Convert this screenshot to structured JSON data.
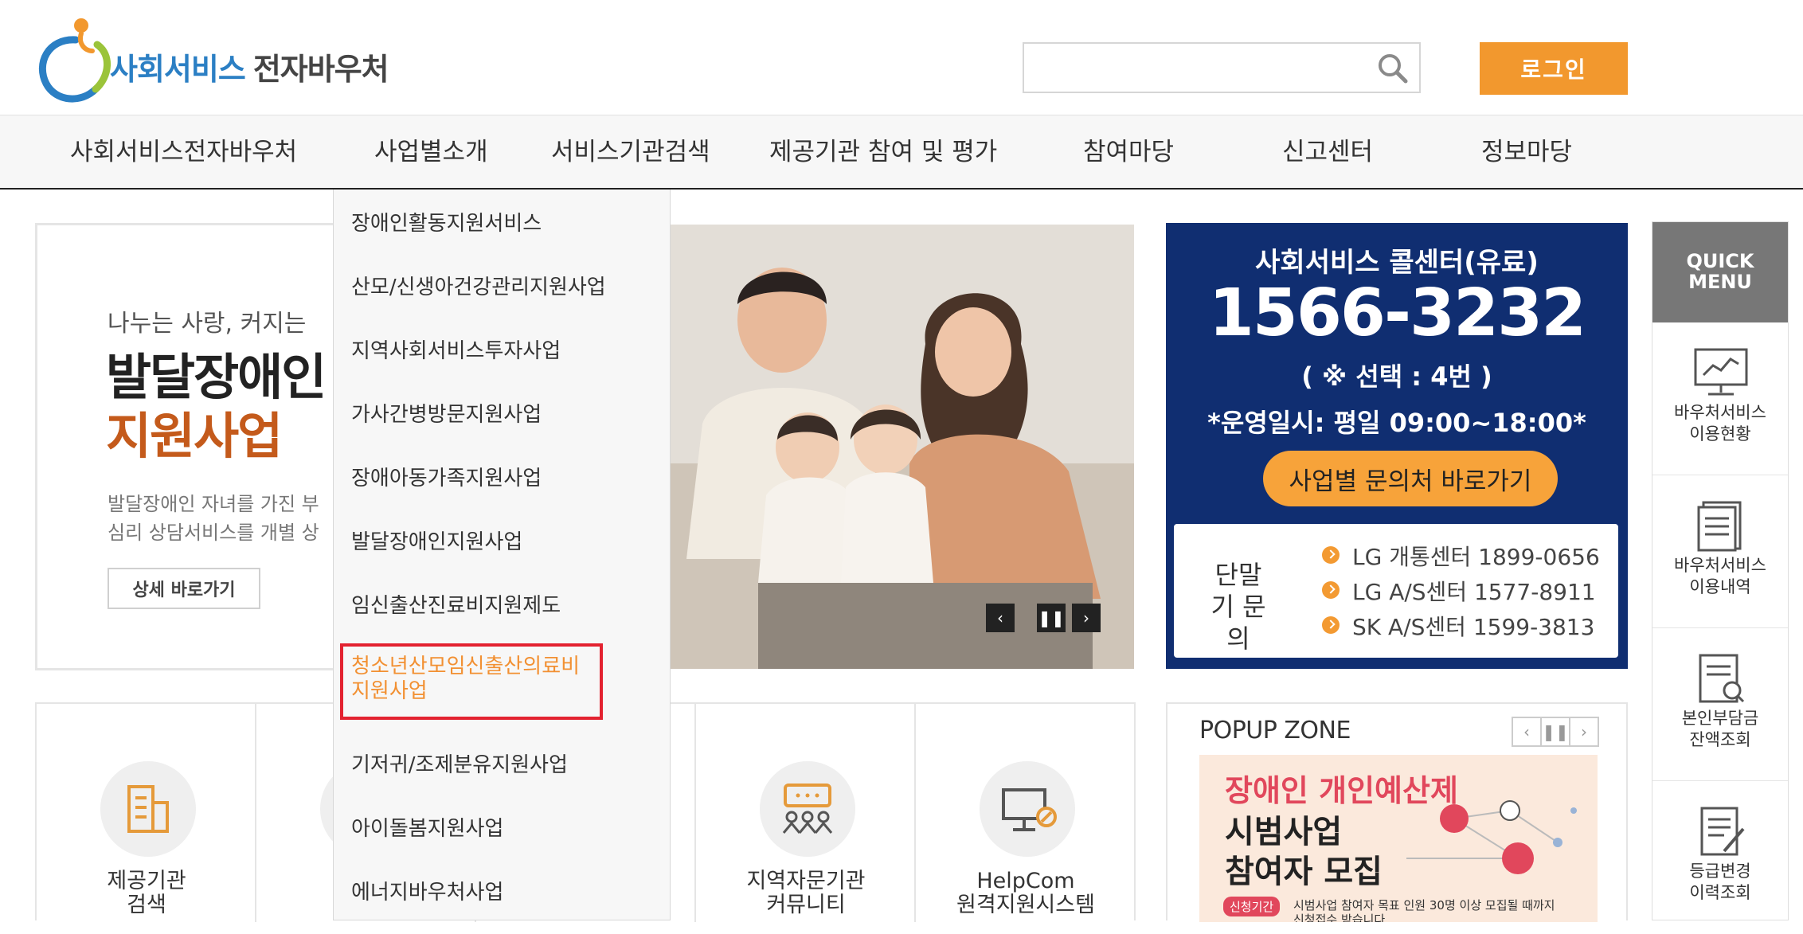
{
  "header": {
    "logo_text_blue": "사회서비스",
    "logo_text_dark": "전자바우처",
    "search_placeholder": "",
    "login_label": "로그인"
  },
  "nav": {
    "items": [
      {
        "label": "사회서비스전자바우처"
      },
      {
        "label": "사업별소개"
      },
      {
        "label": "서비스기관검색"
      },
      {
        "label": "제공기관 참여 및 평가"
      },
      {
        "label": "참여마당"
      },
      {
        "label": "신고센터"
      },
      {
        "label": "정보마당"
      }
    ]
  },
  "dropdown": {
    "items": [
      {
        "label": "장애인활동지원서비스"
      },
      {
        "label": "산모/신생아건강관리지원사업"
      },
      {
        "label": "지역사회서비스투자사업"
      },
      {
        "label": "가사간병방문지원사업"
      },
      {
        "label": "장애아동가족지원사업"
      },
      {
        "label": "발달장애인지원사업"
      },
      {
        "label": "임신출산진료비지원제도"
      },
      {
        "label": "기저귀/조제분유지원사업"
      },
      {
        "label": "아이돌봄지원사업"
      },
      {
        "label": "에너지바우처사업"
      }
    ],
    "highlighted": {
      "line1": "청소년산모임신출산의료비",
      "line2": "지원사업"
    }
  },
  "banner": {
    "subtitle": "나누는 사랑, 커지는 ",
    "title1": "발달장애인",
    "title2": "지원사업",
    "desc1": "발달장애인 자녀를 가진 부",
    "desc2": "심리 상담서비스를 개별 상",
    "button_label": "상세 바로가기",
    "controls": {
      "prev": "‹",
      "pause": "❚❚",
      "next": "›"
    }
  },
  "callcenter": {
    "title": "사회서비스 콜센터(유료)",
    "number": "1566-3232",
    "select": "( ※ 선택 : 4번 )",
    "hours": "*운영일시: 평일 09:00~18:00*",
    "button_label": "사업별 문의처 바로가기",
    "terminal_label": "단말기 문의",
    "lines": [
      {
        "text": "LG 개통센터 1899-0656"
      },
      {
        "text": "LG A/S센터 1577-8911"
      },
      {
        "text": "SK A/S센터 1599-3813"
      }
    ]
  },
  "quick_menu": {
    "title_line1": "QUICK",
    "title_line2": "MENU",
    "items": [
      {
        "line1": "바우처서비스",
        "line2": "이용현황",
        "icon": "monitor-chart-icon"
      },
      {
        "line1": "바우처서비스",
        "line2": "이용내역",
        "icon": "document-list-icon"
      },
      {
        "line1": "본인부담금",
        "line2": "잔액조회",
        "icon": "document-search-icon"
      },
      {
        "line1": "등급변경",
        "line2": "이력조회",
        "icon": "document-edit-icon"
      }
    ]
  },
  "services": [
    {
      "line1": "제공기관",
      "line2": "검색",
      "icon": "building-icon"
    },
    {
      "line1": "",
      "line2": "",
      "icon": "hidden-icon"
    },
    {
      "line1": "",
      "line2": "",
      "icon": "hidden-icon"
    },
    {
      "line1": "지역자문기관",
      "line2": "커뮤니티",
      "icon": "community-icon"
    },
    {
      "line1": "HelpCom",
      "line2": "원격지원시스템",
      "icon": "remote-support-icon"
    }
  ],
  "popup": {
    "title": "POPUP ZONE",
    "line1": "장애인 개인예산제",
    "line2": "시범사업",
    "line3": "참여자 모집",
    "tag": "신청기간",
    "small_text": "시범사업 참여자 목표 인원 30명 이상 모집될 때까지",
    "small_text2": "신청접수 받습니다",
    "controls": {
      "prev": "‹",
      "pause": "❚❚",
      "next": "›"
    }
  },
  "colors": {
    "accent_orange": "#f2982e",
    "navy": "#102e71",
    "highlight_red": "#e32230",
    "logo_blue": "#2b7fc4"
  }
}
